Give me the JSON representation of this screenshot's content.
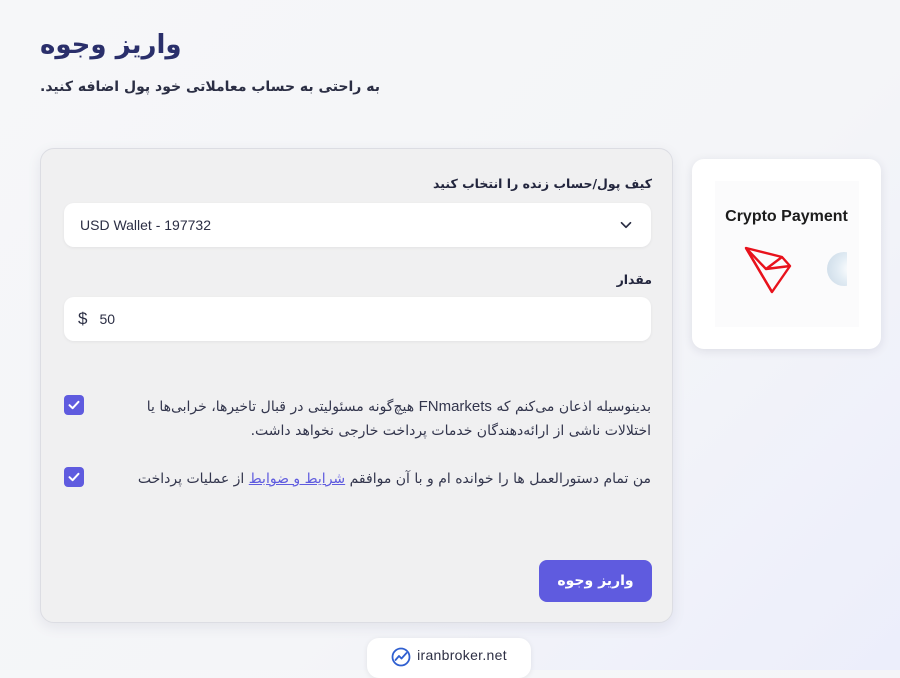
{
  "header": {
    "title": "واریز وجوه",
    "subtitle": "به راحتی به حساب معاملاتی خود پول اضافه کنید."
  },
  "form": {
    "wallet_label": "کیف پول/حساب زنده را انتخاب کنید",
    "wallet_selected": "USD Wallet - 197732",
    "amount_label": "مقدار",
    "currency_symbol": "$",
    "amount_value": "50",
    "disclaimer_before_brand": "هیچ‌گونه مسئولیتی در قبال تاخیرها، خرابی‌ها یا",
    "disclaimer_brand": "FNmarkets",
    "disclaimer_after_brand": "بدینوسیله اذعان می‌کنم که",
    "disclaimer_line2": "اختلالات ناشی از ارائه‌دهندگان خدمات پرداخت خارجی نخواهد داشت.",
    "disclaimer_checked": true,
    "terms_before_link": "من تمام دستورالعمل ها را خوانده ام و با آن موافقم",
    "terms_link": "شرایط و ضوابط",
    "terms_after_link": "از عملیات پرداخت",
    "terms_checked": true,
    "submit_label": "واریز وجوه"
  },
  "payment_method": {
    "title": "Crypto Payment",
    "icons": [
      "tron-logo-icon",
      "coin-icon"
    ]
  },
  "footer": {
    "brand": "iranbroker.net",
    "icon": "chart-trend-icon"
  },
  "colors": {
    "accent": "#5f5bdf",
    "title": "#2a2f6b",
    "tron_red": "#e8121c"
  }
}
